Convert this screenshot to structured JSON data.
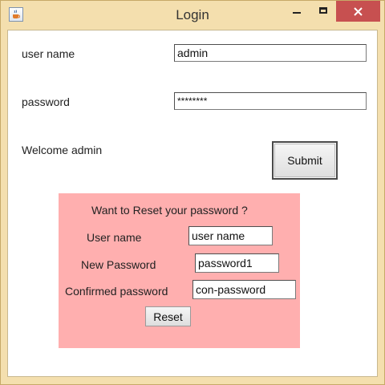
{
  "window": {
    "title": "Login",
    "icon": "java-cup-icon",
    "controls": [
      "minimize-icon",
      "maximize-icon",
      "close-icon"
    ],
    "close_color": "#c75050"
  },
  "login_form": {
    "username_label": "user name",
    "username_value": "admin",
    "password_label": "password",
    "password_value": "********",
    "welcome_text": "Welcome admin",
    "submit_label": "Submit"
  },
  "reset_panel": {
    "background": "#ffafaf",
    "heading": "Want to Reset your password ?",
    "username_label": "User name",
    "username_value": "user name",
    "new_password_label": "New Password",
    "new_password_value": "password1",
    "confirm_password_label": "Confirmed password",
    "confirm_password_value": "con-password",
    "reset_label": "Reset"
  }
}
